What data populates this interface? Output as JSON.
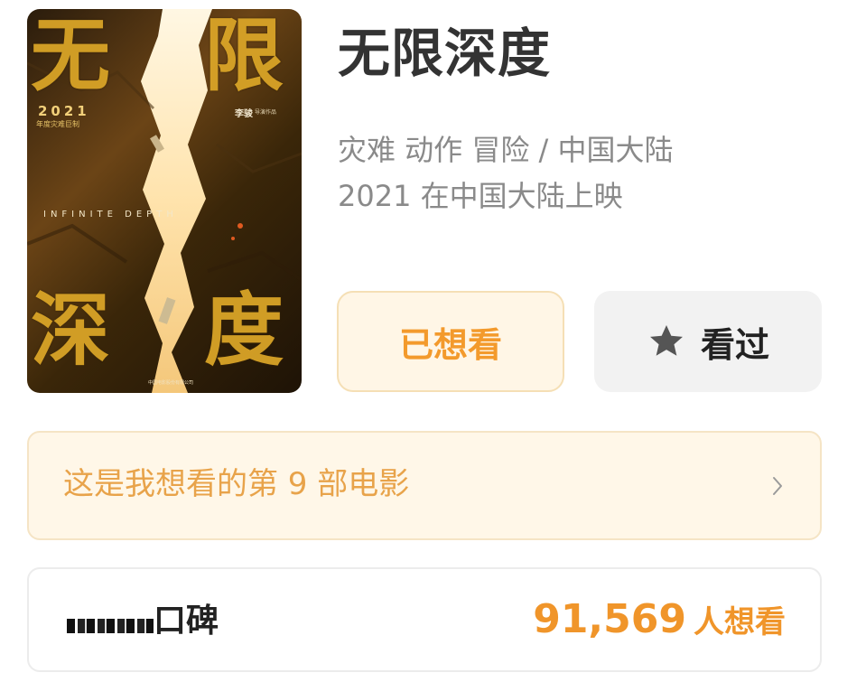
{
  "movie": {
    "title": "无限深度",
    "genres_region": "灾难 动作 冒险 / 中国大陆",
    "release": "2021 在中国大陆上映"
  },
  "poster": {
    "chars": [
      "无",
      "限",
      "深",
      "度"
    ],
    "year": "2021",
    "year_sub": "年度灾难巨制",
    "director": "李骏",
    "director_sub": "导演作品",
    "english_title": "INFINITE DEPTH",
    "studio": "中国电影股份有限公司"
  },
  "actions": {
    "wish_label": "已想看",
    "seen_label": "看过",
    "seen_icon": "star-icon"
  },
  "banner": {
    "text": "这是我想看的第 9 部电影"
  },
  "rating": {
    "label": "口碑",
    "count": "91,569",
    "count_unit": "人想看"
  },
  "colors": {
    "accent_orange": "#f39a2c",
    "banner_bg": "#fff7e8",
    "seen_bg": "#f2f2f2",
    "text_dark": "#333333",
    "text_gray": "#8a8a8a"
  }
}
